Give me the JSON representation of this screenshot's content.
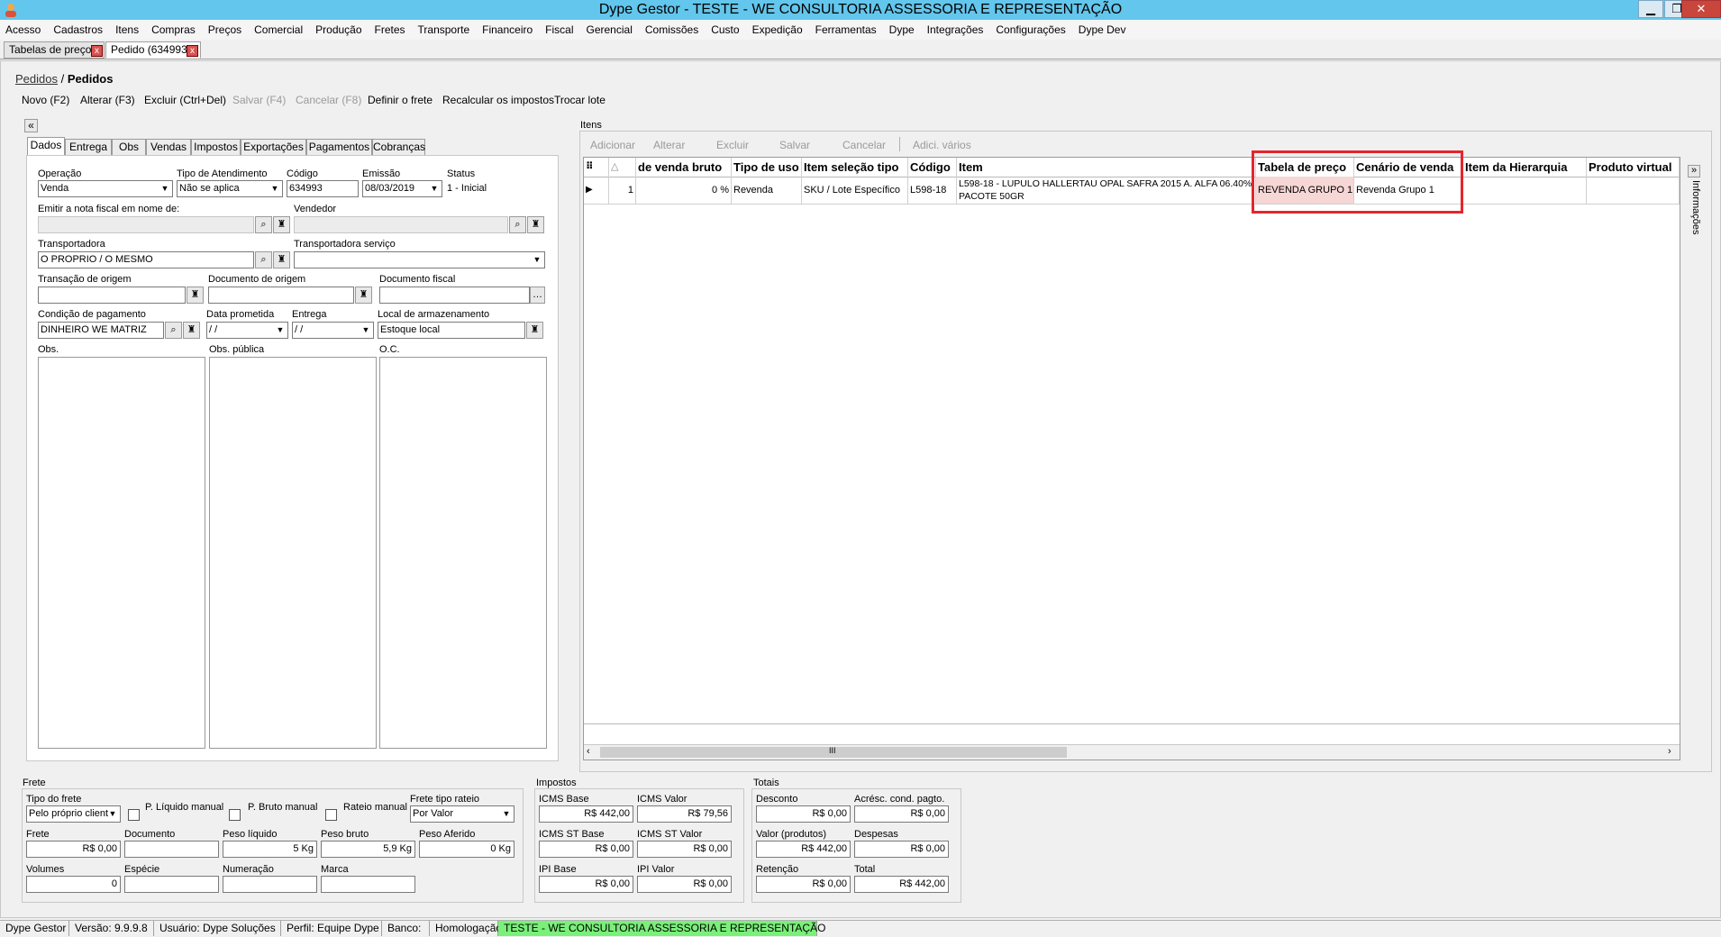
{
  "window": {
    "title": "Dype Gestor - TESTE - WE CONSULTORIA ASSESSORIA E REPRESENTAÇÃO",
    "min": "▁",
    "max": "❐",
    "close": "✕"
  },
  "menu": [
    "Acesso",
    "Cadastros",
    "Itens",
    "Compras",
    "Preços",
    "Comercial",
    "Produção",
    "Fretes",
    "Transporte",
    "Financeiro",
    "Fiscal",
    "Gerencial",
    "Comissões",
    "Custo",
    "Expedição",
    "Ferramentas",
    "Dype",
    "Integrações",
    "Configurações",
    "Dype Dev"
  ],
  "doc_tabs": [
    {
      "label": "Tabelas de preço"
    },
    {
      "label": "Pedido (634993)"
    }
  ],
  "breadcrumb": {
    "link": "Pedidos",
    "sep": "/",
    "current": "Pedidos"
  },
  "toolbar": {
    "novo": "Novo (F2)",
    "alterar": "Alterar (F3)",
    "excluir": "Excluir (Ctrl+Del)",
    "salvar": "Salvar (F4)",
    "cancelar": "Cancelar (F8)",
    "frete": "Definir o frete",
    "recalcular": "Recalcular os impostos",
    "trocar": "Trocar lote"
  },
  "form_tabs": [
    "Dados",
    "Entrega",
    "Obs",
    "Vendas",
    "Impostos",
    "Exportações",
    "Pagamentos",
    "Cobranças"
  ],
  "dados": {
    "operacao_label": "Operação",
    "operacao": "Venda",
    "tipo_atend_label": "Tipo de Atendimento",
    "tipo_atend": "Não se aplica",
    "codigo_label": "Código",
    "codigo": "634993",
    "emissao_label": "Emissão",
    "emissao": "08/03/2019",
    "status_label": "Status",
    "status": "1 - Inicial",
    "emitir_label": "Emitir a nota fiscal em nome de:",
    "vendedor_label": "Vendedor",
    "transportadora_label": "Transportadora",
    "transportadora": "O PROPRIO / O MESMO",
    "transp_servico_label": "Transportadora serviço",
    "transacao_label": "Transação de origem",
    "doc_origem_label": "Documento de origem",
    "doc_fiscal_label": "Documento fiscal",
    "cond_pag_label": "Condição de pagamento",
    "cond_pag": "DINHEIRO WE MATRIZ",
    "data_prom_label": "Data prometida",
    "data_prom": " / /",
    "entrega_label": "Entrega",
    "entrega": " / /",
    "local_label": "Local de armazenamento",
    "local": "Estoque local",
    "obs_label": "Obs.",
    "obs_pub_label": "Obs. pública",
    "oc_label": "O.C."
  },
  "itens": {
    "title": "Itens",
    "toolbar": {
      "adicionar": "Adicionar",
      "alterar": "Alterar",
      "excluir": "Excluir",
      "salvar": "Salvar",
      "cancelar": "Cancelar",
      "adic_varios": "Adici. vários"
    },
    "columns": [
      "de venda bruto",
      "Tipo de uso",
      "Item seleção tipo",
      "Código",
      "Item",
      "Tabela de preço",
      "Cenário de venda",
      "Item da Hierarquia",
      "Produto virtual"
    ],
    "rows": [
      {
        "num": "1",
        "venda_bruto": "0 %",
        "tipo_uso": "Revenda",
        "selecao_tipo": "SKU / Lote Específico",
        "codigo": "L598-18",
        "item": "L598-18 - LUPULO HALLERTAU OPAL SAFRA 2015 A. ALFA 06.40% PACOTE 50GR",
        "tabela": "REVENDA GRUPO 1",
        "cenario": "Revenda Grupo 1",
        "hierarquia": "",
        "virtual": ""
      }
    ],
    "side_panel": "Informações",
    "scroll_grip": "III"
  },
  "frete": {
    "title": "Frete",
    "tipo_label": "Tipo do frete",
    "tipo": "Pelo próprio client",
    "p_liq_label": "P. Líquido manual",
    "p_bruto_label": "P. Bruto manual",
    "rateio_label": "Rateio manual",
    "frete_tipo_label": "Frete tipo rateio",
    "frete_tipo": "Por Valor",
    "frete_label": "Frete",
    "frete": "R$ 0,00",
    "documento_label": "Documento",
    "peso_liq_label": "Peso líquido",
    "peso_liq": "5 Kg",
    "peso_bruto_label": "Peso bruto",
    "peso_bruto": "5,9 Kg",
    "peso_aferido_label": "Peso Aferido",
    "peso_aferido": "0 Kg",
    "volumes_label": "Volumes",
    "volumes": "0",
    "especie_label": "Espécie",
    "numeracao_label": "Numeração",
    "marca_label": "Marca"
  },
  "impostos": {
    "title": "Impostos",
    "icms_base_label": "ICMS Base",
    "icms_base": "R$ 442,00",
    "icms_valor_label": "ICMS Valor",
    "icms_valor": "R$ 79,56",
    "icms_st_base_label": "ICMS ST Base",
    "icms_st_base": "R$ 0,00",
    "icms_st_valor_label": "ICMS ST Valor",
    "icms_st_valor": "R$ 0,00",
    "ipi_base_label": "IPI Base",
    "ipi_base": "R$ 0,00",
    "ipi_valor_label": "IPI Valor",
    "ipi_valor": "R$ 0,00"
  },
  "totais": {
    "title": "Totais",
    "desconto_label": "Desconto",
    "desconto": "R$ 0,00",
    "acresc_label": "Acrésc. cond. pagto.",
    "acresc": "R$ 0,00",
    "valor_prod_label": "Valor (produtos)",
    "valor_prod": "R$ 442,00",
    "despesas_label": "Despesas",
    "despesas": "R$ 0,00",
    "retencao_label": "Retenção",
    "retencao": "R$ 0,00",
    "total_label": "Total",
    "total": "R$ 442,00"
  },
  "statusbar": {
    "app": "Dype Gestor",
    "versao": "Versão: 9.9.9.8",
    "usuario": "Usuário: Dype Soluções",
    "perfil": "Perfil: Equipe Dype",
    "banco": "Banco:",
    "homolog": "Homologação",
    "empresa": "TESTE - WE CONSULTORIA ASSESSORIA E REPRESENTAÇÃO"
  },
  "colors": {
    "titlebar": "#63c6ec",
    "highlight": "#e3262d",
    "status_green": "#7af07a"
  }
}
